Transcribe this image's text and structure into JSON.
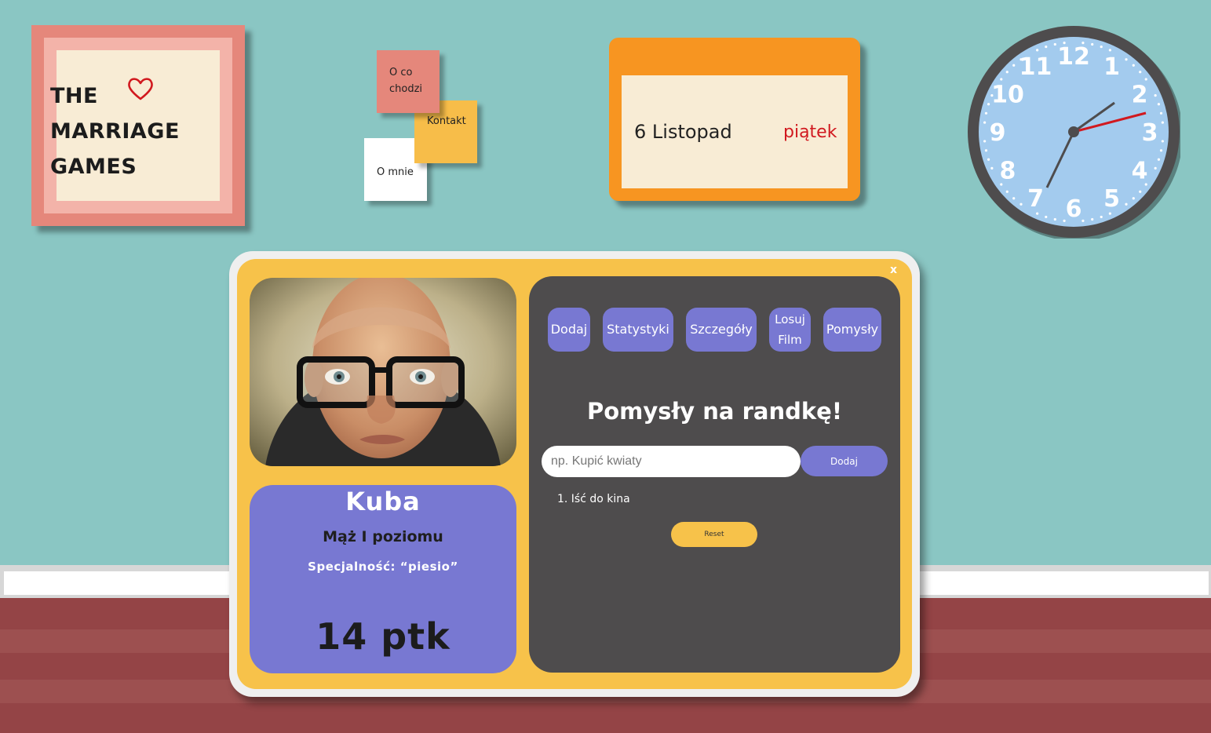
{
  "logo": {
    "line1": "THE",
    "line2": "MARRIAGE",
    "line3": "GAMES"
  },
  "notes": {
    "oco": "O co chodzi",
    "kontakt": "Kontakt",
    "omnie": "O mnie"
  },
  "date": {
    "day": "6 Listopad",
    "weekday": "piątek"
  },
  "clock": {
    "numbers": [
      "12",
      "1",
      "2",
      "3",
      "4",
      "5",
      "6",
      "7",
      "8",
      "9",
      "10",
      "11"
    ],
    "face_color": "#a3cbee",
    "rim_color": "#4e4c4d",
    "second_hand_color": "#d1191f"
  },
  "modal": {
    "close_label": "x",
    "photo_alt": "Kuba",
    "profile": {
      "name": "Kuba",
      "rank": "Mąż I poziomu",
      "specialty": "Specjalność: “piesio”",
      "points": "14 ptk"
    },
    "tabs": [
      {
        "label": "Dodaj"
      },
      {
        "label": "Statystyki"
      },
      {
        "label": "Szczegóły"
      },
      {
        "label": "Losuj Film"
      },
      {
        "label": "Pomysły"
      }
    ],
    "ideas": {
      "title": "Pomysły na randkę!",
      "input_placeholder": "np. Kupić kwiaty",
      "input_value": "",
      "add_label": "Dodaj",
      "items": [
        "1. Iść do kina"
      ],
      "reset_label": "Reset"
    }
  },
  "colors": {
    "wall": "#8ac6c3",
    "accent_yellow": "#f7c24a",
    "accent_purple": "#7878d2",
    "panel_dark": "#4e4c4d",
    "orange": "#f79521",
    "salmon": "#e5877b"
  }
}
